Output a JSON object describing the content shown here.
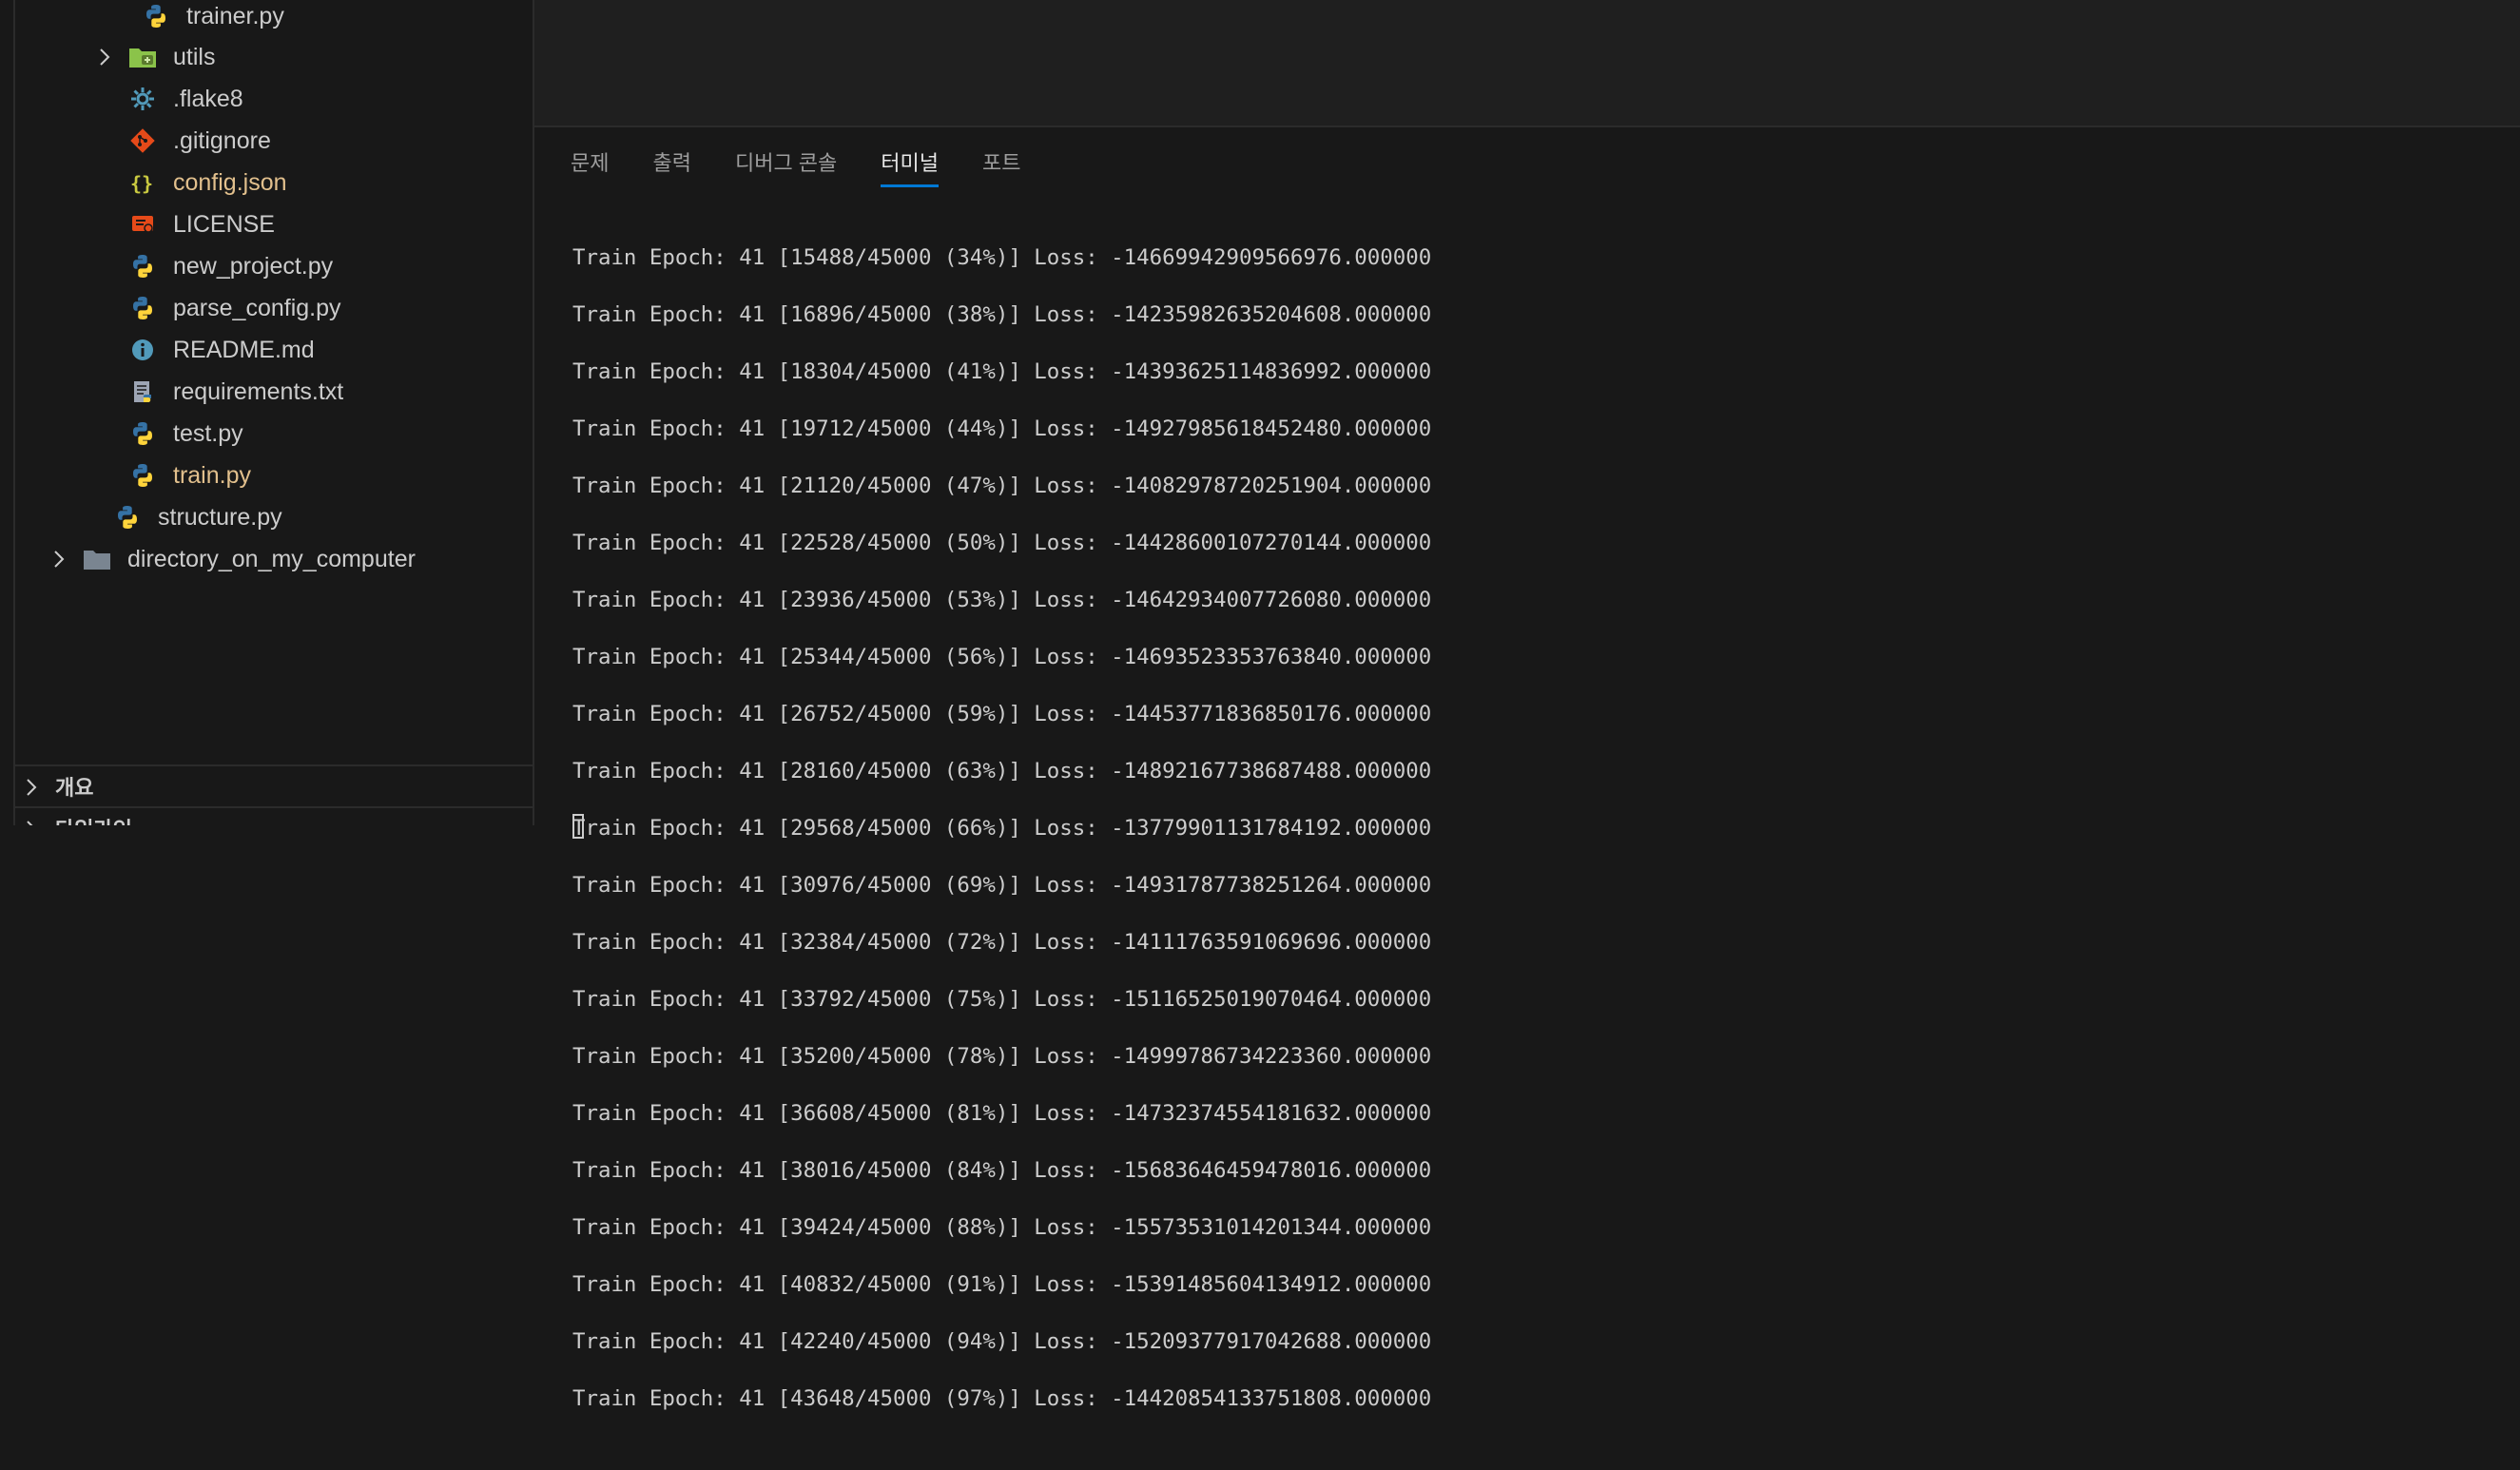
{
  "explorer": {
    "items": [
      {
        "label": "trainer.py",
        "icon": "python-icon",
        "status": ""
      },
      {
        "label": "utils",
        "icon": "folder-icon",
        "status": ""
      },
      {
        "label": ".flake8",
        "icon": "gear-icon",
        "status": ""
      },
      {
        "label": ".gitignore",
        "icon": "git-icon",
        "status": ""
      },
      {
        "label": "config.json",
        "icon": "json-icon",
        "status": "M"
      },
      {
        "label": "LICENSE",
        "icon": "license-icon",
        "status": ""
      },
      {
        "label": "new_project.py",
        "icon": "python-icon",
        "status": ""
      },
      {
        "label": "parse_config.py",
        "icon": "python-icon",
        "status": ""
      },
      {
        "label": "README.md",
        "icon": "info-icon",
        "status": ""
      },
      {
        "label": "requirements.txt",
        "icon": "text-file-icon",
        "status": ""
      },
      {
        "label": "test.py",
        "icon": "python-icon",
        "status": ""
      },
      {
        "label": "train.py",
        "icon": "python-icon",
        "status": "M"
      },
      {
        "label": "structure.py",
        "icon": "python-icon",
        "status": ""
      },
      {
        "label": "directory_on_my_computer",
        "icon": "folder-icon",
        "status": ""
      }
    ],
    "sections": [
      {
        "label": "개요"
      },
      {
        "label": "타임라인"
      }
    ]
  },
  "panel": {
    "tabs": [
      "문제",
      "출력",
      "디버그 콘솔",
      "터미널",
      "포트"
    ],
    "active_tab": "터미널",
    "terminal_lines": [
      "Train Epoch: 41 [15488/45000 (34%)] Loss: -14669942909566976.000000",
      "Train Epoch: 41 [16896/45000 (38%)] Loss: -14235982635204608.000000",
      "Train Epoch: 41 [18304/45000 (41%)] Loss: -14393625114836992.000000",
      "Train Epoch: 41 [19712/45000 (44%)] Loss: -14927985618452480.000000",
      "Train Epoch: 41 [21120/45000 (47%)] Loss: -14082978720251904.000000",
      "Train Epoch: 41 [22528/45000 (50%)] Loss: -14428600107270144.000000",
      "Train Epoch: 41 [23936/45000 (53%)] Loss: -14642934007726080.000000",
      "Train Epoch: 41 [25344/45000 (56%)] Loss: -14693523353763840.000000",
      "Train Epoch: 41 [26752/45000 (59%)] Loss: -14453771836850176.000000",
      "Train Epoch: 41 [28160/45000 (63%)] Loss: -14892167738687488.000000",
      "Train Epoch: 41 [29568/45000 (66%)] Loss: -13779901131784192.000000",
      "Train Epoch: 41 [30976/45000 (69%)] Loss: -14931787738251264.000000",
      "Train Epoch: 41 [32384/45000 (72%)] Loss: -14111763591069696.000000",
      "Train Epoch: 41 [33792/45000 (75%)] Loss: -15116525019070464.000000",
      "Train Epoch: 41 [35200/45000 (78%)] Loss: -14999786734223360.000000",
      "Train Epoch: 41 [36608/45000 (81%)] Loss: -14732374554181632.000000",
      "Train Epoch: 41 [38016/45000 (84%)] Loss: -15683646459478016.000000",
      "Train Epoch: 41 [39424/45000 (88%)] Loss: -15573531014201344.000000",
      "Train Epoch: 41 [40832/45000 (91%)] Loss: -15391485604134912.000000",
      "Train Epoch: 41 [42240/45000 (94%)] Loss: -15209377917042688.000000",
      "Train Epoch: 41 [43648/45000 (97%)] Loss: -14420854133751808.000000"
    ]
  },
  "colors": {
    "accent": "#0078d4",
    "modified": "#e2c08d",
    "python": "#3572a5",
    "python_yellow": "#ffd43b"
  }
}
